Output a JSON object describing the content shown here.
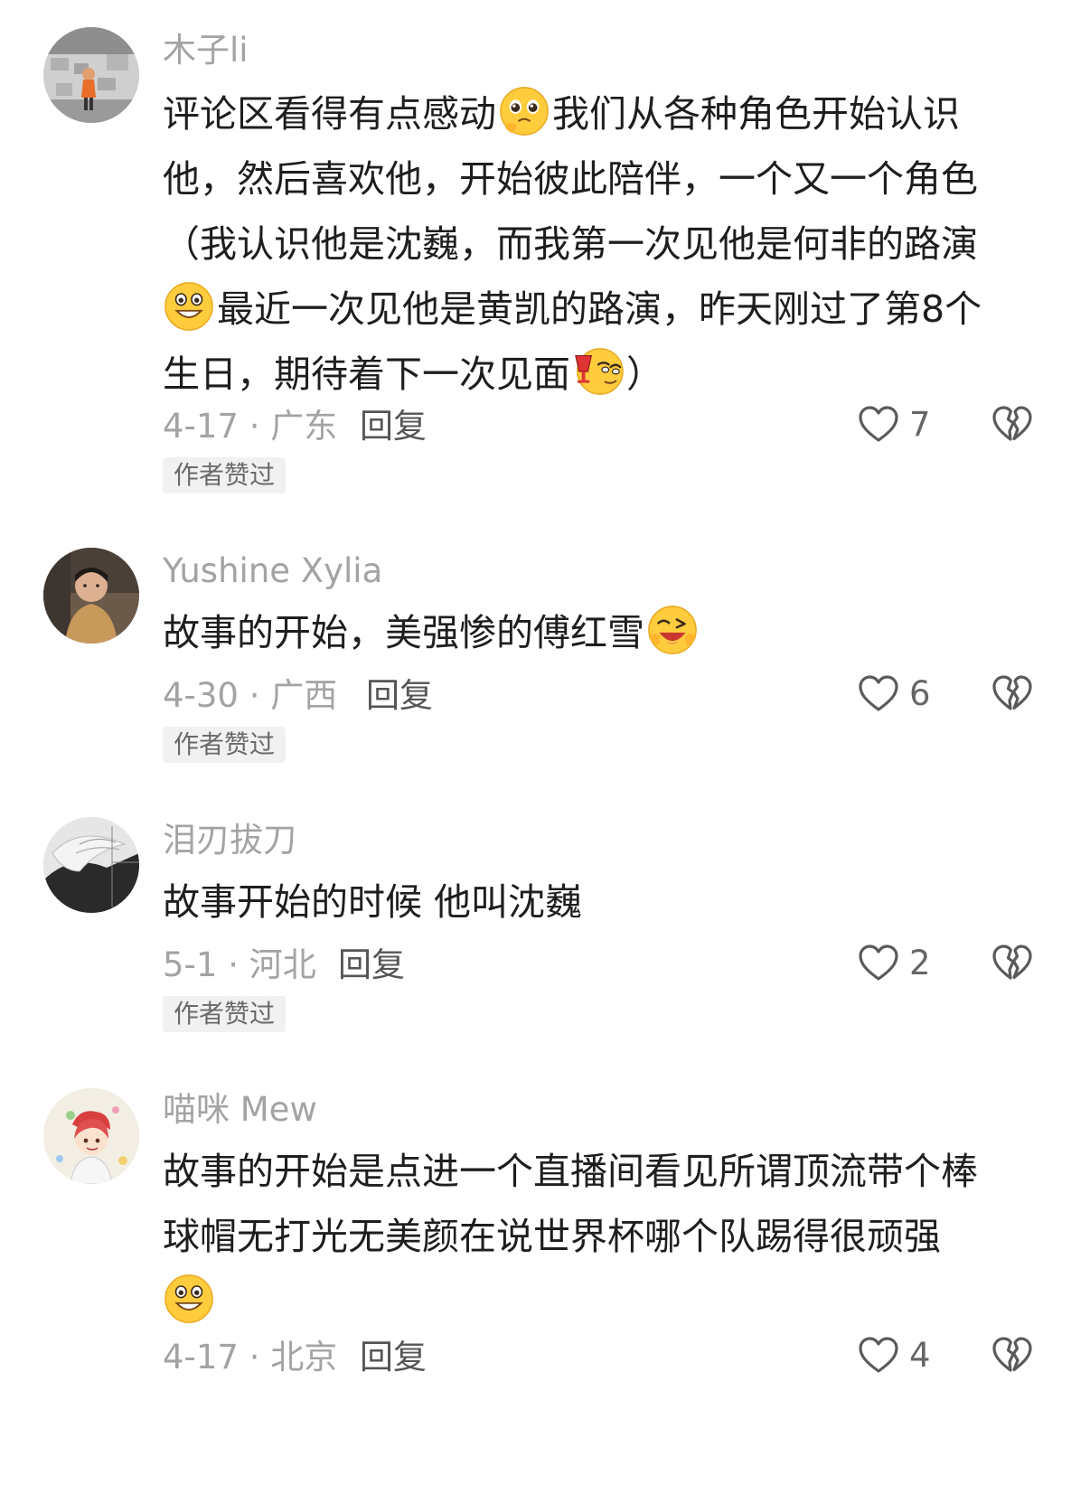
{
  "icons": {
    "like": "heart-outline-icon",
    "dislike": "broken-heart-icon"
  },
  "comments": [
    {
      "username": "木子li",
      "lines": [
        [
          "评论区看得有点感动",
          "[emoji:pleading]",
          "我们从各种角色开始认识"
        ],
        [
          "他，然后喜欢他，开始彼此陪伴，一个又一个角色"
        ],
        [
          "（我认识他是沈巍，而我第一次见他是何非的路演"
        ],
        [
          "[emoji:grin]",
          "最近一次见他是黄凯的路演，昨天刚过了第8个"
        ],
        [
          "生日，期待着下一次见面",
          "[emoji:drink]",
          "）"
        ]
      ],
      "line_1": "评论区看得有点感动",
      "line_1b": "我们从各种角色开始认识",
      "line_2": "他，然后喜欢他，开始彼此陪伴，一个又一个角色",
      "line_3": "（我认识他是沈巍，而我第一次见他是何非的路演",
      "line_4": "最近一次见他是黄凯的路演，昨天刚过了第8个",
      "line_5": "生日，期待着下一次见面",
      "line_5b": "）",
      "date_location": "4-17 · 广东",
      "reply": "回复",
      "likes": "7",
      "badge": "作者赞过"
    },
    {
      "username": "Yushine Xylia",
      "line_1": "故事的开始，美强惨的傅红雪",
      "date_location": "4-30 · 广西",
      "reply": "回复",
      "likes": "6",
      "badge": "作者赞过"
    },
    {
      "username": "泪刃拔刀",
      "line_1": "故事开始的时候 他叫沈巍",
      "date_location": "5-1 · 河北",
      "reply": "回复",
      "likes": "2",
      "badge": "作者赞过"
    },
    {
      "username": "喵咪 Mew",
      "line_1": "故事的开始是点进一个直播间看见所谓顶流带个棒",
      "line_2": "球帽无打光无美颜在说世界杯哪个队踢得很顽强",
      "date_location": "4-17 · 北京",
      "reply": "回复",
      "likes": "4"
    }
  ]
}
